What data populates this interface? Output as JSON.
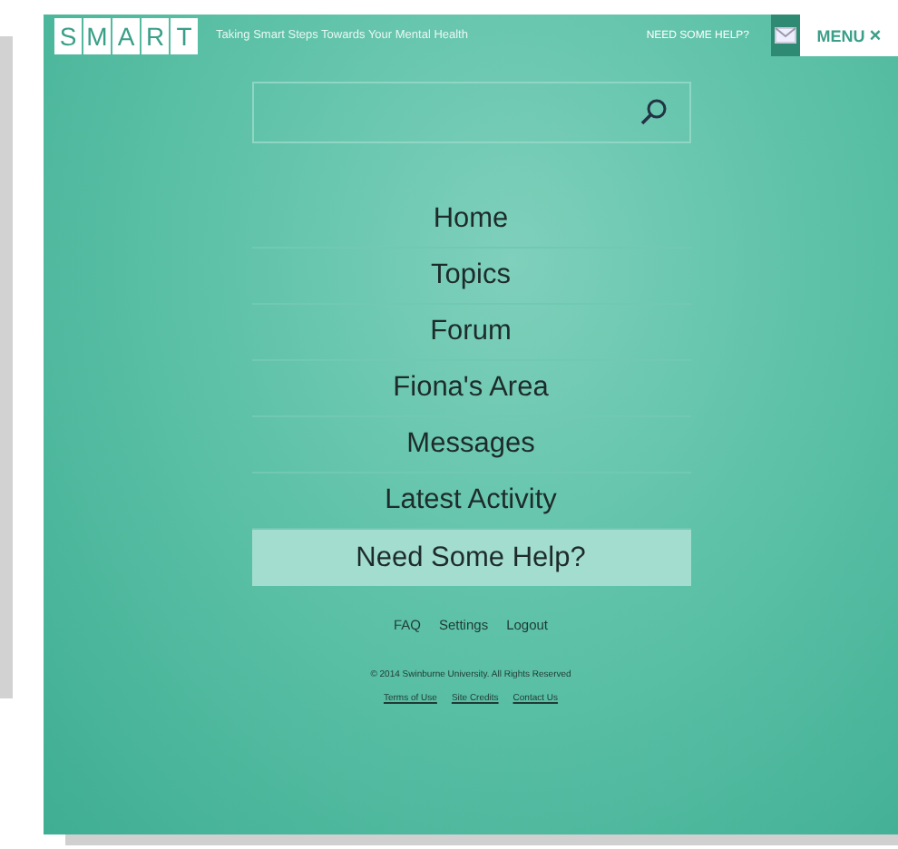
{
  "header": {
    "logo_letters": [
      "S",
      "M",
      "A",
      "R",
      "T"
    ],
    "tagline": "Taking Smart Steps Towards Your Mental Health",
    "help_link": "NEED SOME HELP?",
    "menu_button": "MENU",
    "close_glyph": "×"
  },
  "nav": [
    {
      "label": "Home",
      "selected": false
    },
    {
      "label": "Topics",
      "selected": false
    },
    {
      "label": "Forum",
      "selected": false
    },
    {
      "label": "Fiona's Area",
      "selected": false
    },
    {
      "label": "Messages",
      "selected": false
    },
    {
      "label": "Latest Activity",
      "selected": false
    },
    {
      "label": "Need Some Help?",
      "selected": true
    }
  ],
  "footer_links": [
    "FAQ",
    "Settings",
    "Logout"
  ],
  "copyright": "© 2014 Swinburne University. All Rights Reserved",
  "legal_links": [
    "Terms of Use",
    "Site Credits",
    "Contact Us"
  ]
}
